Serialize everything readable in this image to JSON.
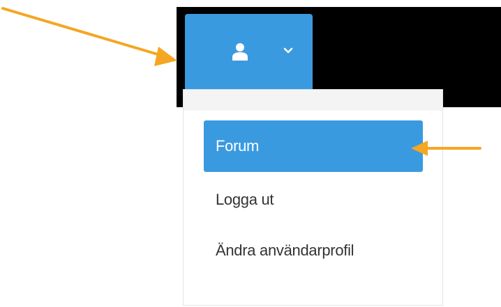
{
  "header": {
    "user_menu": {
      "icon": "user-icon",
      "chevron": "chevron-down-icon",
      "background": "#3a9ae0"
    },
    "bar_color": "#000000"
  },
  "dropdown": {
    "items": [
      {
        "label": "Forum",
        "active": true
      },
      {
        "label": "Logga ut",
        "active": false
      },
      {
        "label": "Ändra användarprofil",
        "active": false
      }
    ],
    "active_color": "#3a9ae0"
  },
  "annotations": {
    "arrow_color": "#f5a623"
  }
}
